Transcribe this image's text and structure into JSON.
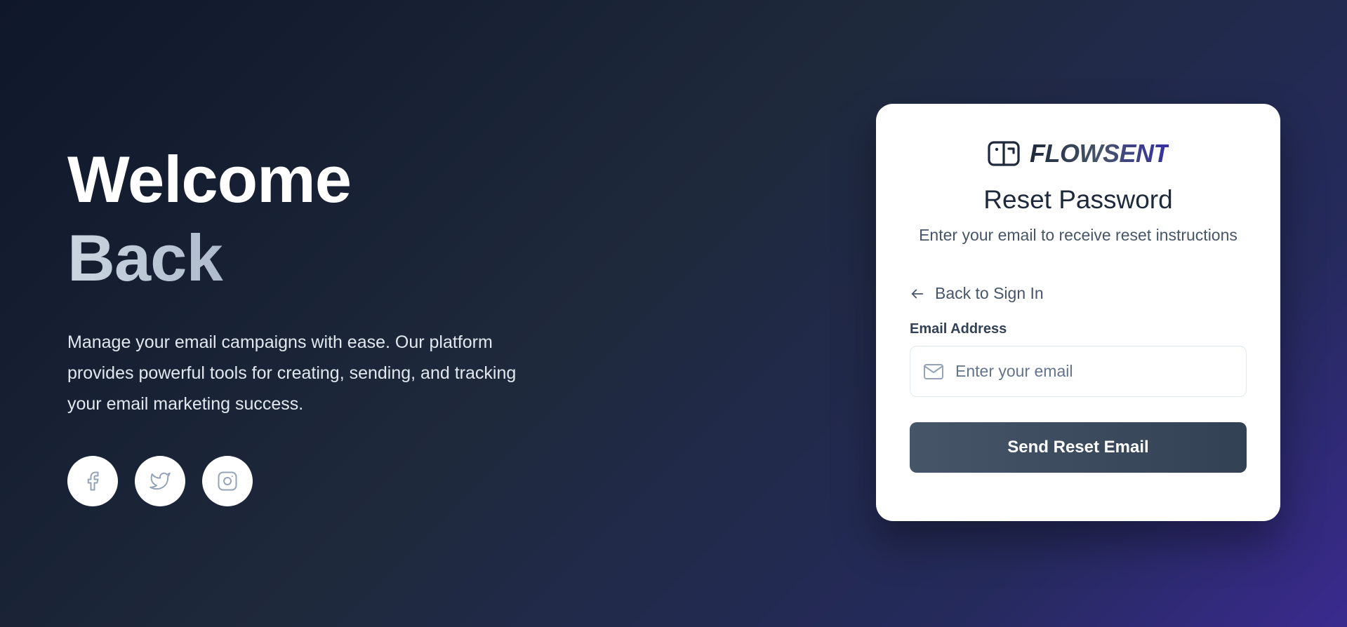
{
  "hero": {
    "title_line1": "Welcome",
    "title_line2": "Back",
    "description": "Manage your email campaigns with ease. Our platform provides powerful tools for creating, sending, and tracking your email marketing success."
  },
  "socials": [
    {
      "name": "facebook",
      "icon": "facebook-icon"
    },
    {
      "name": "twitter",
      "icon": "twitter-icon"
    },
    {
      "name": "instagram",
      "icon": "instagram-icon"
    }
  ],
  "card": {
    "brand_name": "FLOWSENT",
    "title": "Reset Password",
    "subtitle": "Enter your email to receive reset instructions",
    "back_link": "Back to Sign In",
    "email_label": "Email Address",
    "email_placeholder": "Enter your email",
    "email_value": "",
    "submit_label": "Send Reset Email"
  },
  "colors": {
    "accent": "#334155",
    "brand_end": "#3730a3",
    "background_start": "#0f172a",
    "background_end": "#3a2a8f"
  }
}
